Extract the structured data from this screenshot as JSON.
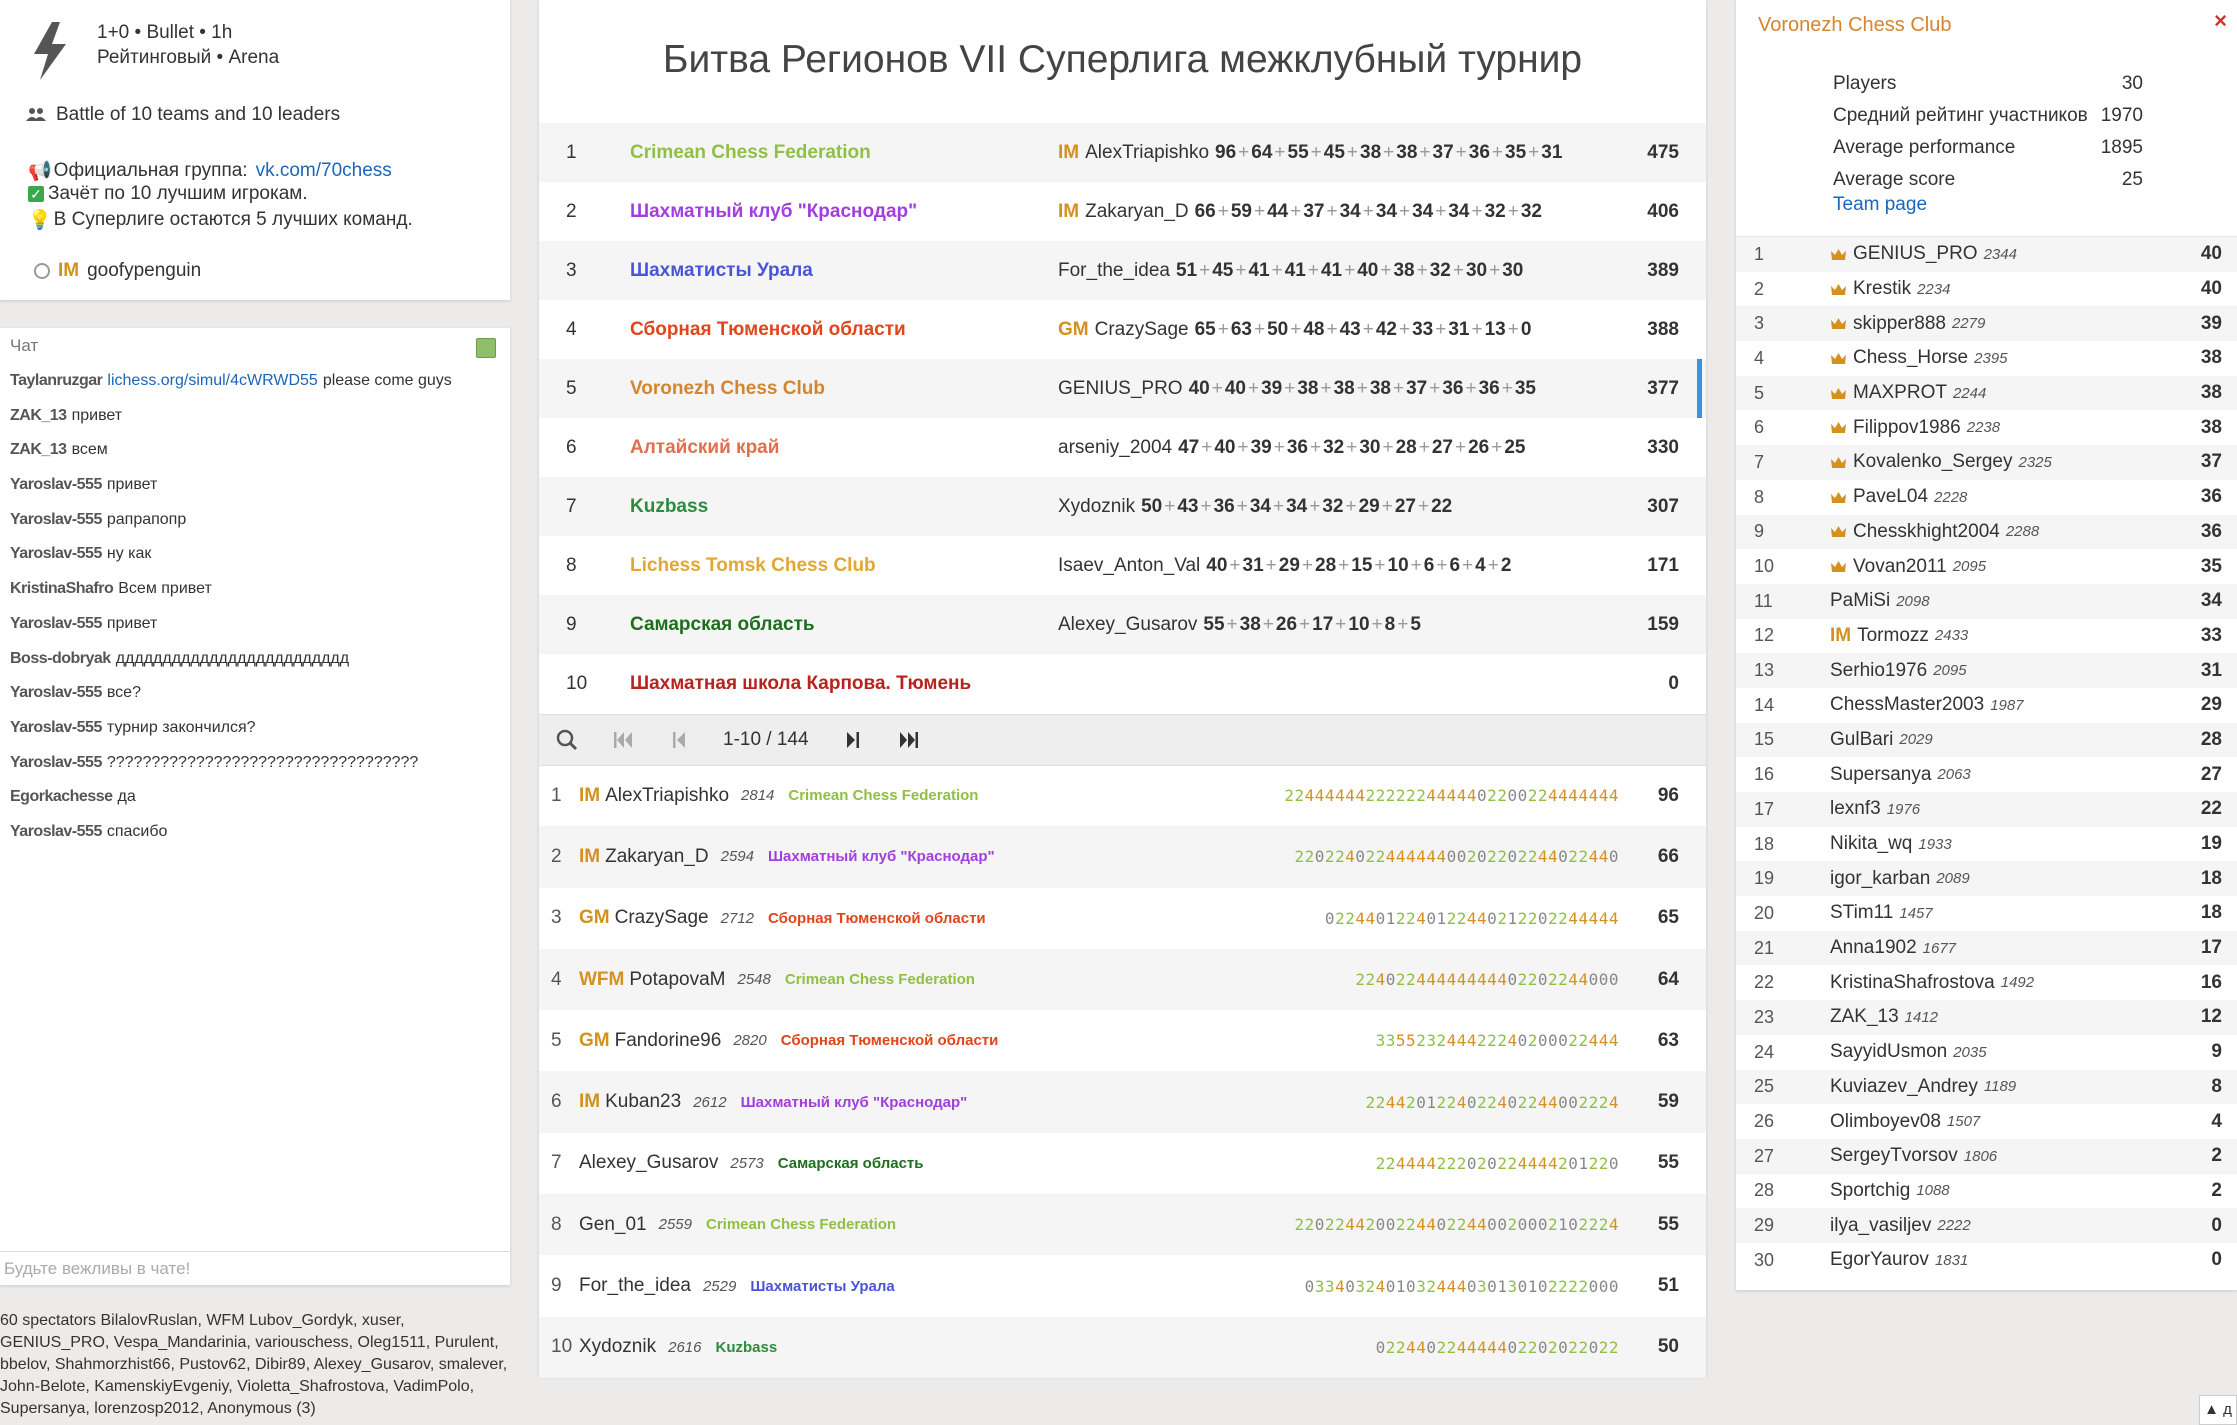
{
  "info": {
    "line1": "1+0 • Bullet • 1h",
    "line2": "Рейтинговый • Arena",
    "battle": "Battle of 10 teams and 10 leaders",
    "group_label": "Официальная группа:",
    "group_link": "vk.com/70chess",
    "rule1": "Зачёт по 10 лучшим игрокам.",
    "rule2": "В Суперлиге остаются 5 лучших команд.",
    "creator_title": "IM",
    "creator": "goofypenguin"
  },
  "chat": {
    "header": "Чат",
    "messages": [
      {
        "user": "Taylanruzgar",
        "link": "lichess.org/simul/4cWRWD55",
        "text": "please come guys"
      },
      {
        "user": "ZAK_13",
        "text": "привет"
      },
      {
        "user": "ZAK_13",
        "text": "всем"
      },
      {
        "user": "Yaroslav-555",
        "text": "привет"
      },
      {
        "user": "Yaroslav-555",
        "text": "рапрапопр"
      },
      {
        "user": "Yaroslav-555",
        "text": "ну как"
      },
      {
        "user": "KristinaShafro",
        "text": "Всем привет"
      },
      {
        "user": "Yaroslav-555",
        "text": "привет"
      },
      {
        "user": "Boss-dobryak",
        "text": "ддддддддддддддддддддддддд"
      },
      {
        "user": "Yaroslav-555",
        "text": "все?"
      },
      {
        "user": "Yaroslav-555",
        "text": "турнир закончился?"
      },
      {
        "user": "Yaroslav-555",
        "text": "???????????????????????????????????"
      },
      {
        "user": "Egorkachesse",
        "text": "да"
      },
      {
        "user": "Yaroslav-555",
        "text": "спасибо"
      }
    ],
    "placeholder": "Будьте вежливы в чате!"
  },
  "spectators": "60 spectators BilalovRuslan, WFM Lubov_Gordyk, xuser, GENIUS_PRO, Vespa_Mandarinia, variouschess, Oleg1511, Purulent, bbelov, Shahmorzhist66, Pustov62, Dibir89, Alexey_Gusarov, smalever, John-Belote, KamenskiyEvgeniy, Violetta_Shafrostova, VadimPolo, Supersanya, lorenzosp2012, Anonymous (3)",
  "tournament_title": "Битва Регионов VII Суперлига межклубный турнир",
  "teams": [
    {
      "rank": "1",
      "name": "Crimean Chess Federation",
      "color": "#8fbf44",
      "leader_title": "IM",
      "leader": "AlexTriapishko",
      "scores": [
        "96",
        "64",
        "55",
        "45",
        "38",
        "38",
        "37",
        "36",
        "35",
        "31"
      ],
      "total": "475"
    },
    {
      "rank": "2",
      "name": "Шахматный клуб \"Краснодар\"",
      "color": "#a23ee0",
      "leader_title": "IM",
      "leader": "Zakaryan_D",
      "scores": [
        "66",
        "59",
        "44",
        "37",
        "34",
        "34",
        "34",
        "34",
        "32",
        "32"
      ],
      "total": "406"
    },
    {
      "rank": "3",
      "name": "Шахматисты Урала",
      "color": "#4a55d6",
      "leader_title": "",
      "leader": "For_the_idea",
      "scores": [
        "51",
        "45",
        "41",
        "41",
        "41",
        "40",
        "38",
        "32",
        "30",
        "30"
      ],
      "total": "389"
    },
    {
      "rank": "4",
      "name": "Сборная Тюменской области",
      "color": "#e0451b",
      "leader_title": "GM",
      "leader": "CrazySage",
      "scores": [
        "65",
        "63",
        "50",
        "48",
        "43",
        "42",
        "33",
        "31",
        "13",
        "0"
      ],
      "total": "388"
    },
    {
      "rank": "5",
      "name": "Voronezh Chess Club",
      "color": "#d3852f",
      "leader_title": "",
      "leader": "GENIUS_PRO",
      "scores": [
        "40",
        "40",
        "39",
        "38",
        "38",
        "38",
        "37",
        "36",
        "36",
        "35"
      ],
      "total": "377"
    },
    {
      "rank": "6",
      "name": "Алтайский край",
      "color": "#e0704b",
      "leader_title": "",
      "leader": "arseniy_2004",
      "scores": [
        "47",
        "40",
        "39",
        "36",
        "32",
        "30",
        "28",
        "27",
        "26",
        "25"
      ],
      "total": "330"
    },
    {
      "rank": "7",
      "name": "Kuzbass",
      "color": "#2e8b3e",
      "leader_title": "",
      "leader": "Xydoznik",
      "scores": [
        "50",
        "43",
        "36",
        "34",
        "34",
        "32",
        "29",
        "27",
        "22"
      ],
      "total": "307"
    },
    {
      "rank": "8",
      "name": "Lichess Tomsk Chess Club",
      "color": "#e2a732",
      "leader_title": "",
      "leader": "Isaev_Anton_Val",
      "scores": [
        "40",
        "31",
        "29",
        "28",
        "15",
        "10",
        "6",
        "6",
        "4",
        "2"
      ],
      "total": "171"
    },
    {
      "rank": "9",
      "name": "Самарская область",
      "color": "#1d6f1d",
      "leader_title": "",
      "leader": "Alexey_Gusarov",
      "scores": [
        "55",
        "38",
        "26",
        "17",
        "10",
        "8",
        "5"
      ],
      "total": "159"
    },
    {
      "rank": "10",
      "name": "Шахматная школа Карпова. Тюмень",
      "color": "#b8231e",
      "leader_title": "",
      "leader": "",
      "scores": [],
      "total": "0"
    }
  ],
  "pager": {
    "info": "1-10 / 144"
  },
  "players": [
    {
      "rank": "1",
      "title": "IM",
      "name": "AlexTriapishko",
      "rating": "2814",
      "team": "Crimean Chess Federation",
      "team_color": "#8fbf44",
      "sheet": "224444442222224444402200224444444",
      "score": "96"
    },
    {
      "rank": "2",
      "title": "IM",
      "name": "Zakaryan_D",
      "rating": "2594",
      "team": "Шахматный клуб \"Краснодар\"",
      "team_color": "#a23ee0",
      "sheet": "22022402244444400202202244022440",
      "score": "66"
    },
    {
      "rank": "3",
      "title": "GM",
      "name": "CrazySage",
      "rating": "2712",
      "team": "Сборная Тюменской области",
      "team_color": "#e0451b",
      "sheet": "02244012240122440212202244444",
      "score": "65"
    },
    {
      "rank": "4",
      "title": "WFM",
      "name": "PotapovaM",
      "rating": "2548",
      "team": "Crimean Chess Federation",
      "team_color": "#8fbf44",
      "sheet": "22402244444444402202244000",
      "score": "64"
    },
    {
      "rank": "5",
      "title": "GM",
      "name": "Fandorine96",
      "rating": "2820",
      "team": "Сборная Тюменской области",
      "team_color": "#e0451b",
      "sheet": "335523244422240200022444",
      "score": "63"
    },
    {
      "rank": "6",
      "title": "IM",
      "name": "Kuban23",
      "rating": "2612",
      "team": "Шахматный клуб \"Краснодар\"",
      "team_color": "#a23ee0",
      "sheet": "2244201224022402244002224",
      "score": "59"
    },
    {
      "rank": "7",
      "title": "",
      "name": "Alexey_Gusarov",
      "rating": "2573",
      "team": "Самарская область",
      "team_color": "#1d6f1d",
      "sheet": "224444222020224444201220",
      "score": "55"
    },
    {
      "rank": "8",
      "title": "",
      "name": "Gen_01",
      "rating": "2559",
      "team": "Crimean Chess Federation",
      "team_color": "#8fbf44",
      "sheet": "22022442002244022440020002102224",
      "score": "55"
    },
    {
      "rank": "9",
      "title": "",
      "name": "For_the_idea",
      "rating": "2529",
      "team": "Шахматисты Урала",
      "team_color": "#4a55d6",
      "sheet": "0334032401032444030130102222000",
      "score": "51"
    },
    {
      "rank": "10",
      "title": "",
      "name": "Xydoznik",
      "rating": "2616",
      "team": "Kuzbass",
      "team_color": "#2e8b3e",
      "sheet": "022440224444402202022022",
      "score": "50"
    }
  ],
  "team_panel": {
    "name": "Voronezh Chess Club",
    "close": "×",
    "stats": [
      {
        "label": "Players",
        "value": "30"
      },
      {
        "label": "Средний рейтинг участников",
        "value": "1970"
      },
      {
        "label": "Average performance",
        "value": "1895"
      },
      {
        "label": "Average score",
        "value": "25"
      }
    ],
    "team_page": "Team page",
    "members": [
      {
        "rank": "1",
        "crown": true,
        "title": "",
        "name": "GENIUS_PRO",
        "rating": "2344",
        "score": "40"
      },
      {
        "rank": "2",
        "crown": true,
        "title": "",
        "name": "Krestik",
        "rating": "2234",
        "score": "40"
      },
      {
        "rank": "3",
        "crown": true,
        "title": "",
        "name": "skipper888",
        "rating": "2279",
        "score": "39"
      },
      {
        "rank": "4",
        "crown": true,
        "title": "",
        "name": "Chess_Horse",
        "rating": "2395",
        "score": "38"
      },
      {
        "rank": "5",
        "crown": true,
        "title": "",
        "name": "MAXPROT",
        "rating": "2244",
        "score": "38"
      },
      {
        "rank": "6",
        "crown": true,
        "title": "",
        "name": "Filippov1986",
        "rating": "2238",
        "score": "38"
      },
      {
        "rank": "7",
        "crown": true,
        "title": "",
        "name": "Kovalenko_Sergey",
        "rating": "2325",
        "score": "37"
      },
      {
        "rank": "8",
        "crown": true,
        "title": "",
        "name": "PaveL04",
        "rating": "2228",
        "score": "36"
      },
      {
        "rank": "9",
        "crown": true,
        "title": "",
        "name": "Chesskhight2004",
        "rating": "2288",
        "score": "36"
      },
      {
        "rank": "10",
        "crown": true,
        "title": "",
        "name": "Vovan2011",
        "rating": "2095",
        "score": "35"
      },
      {
        "rank": "11",
        "crown": false,
        "title": "",
        "name": "PaMiSi",
        "rating": "2098",
        "score": "34"
      },
      {
        "rank": "12",
        "crown": false,
        "title": "IM",
        "name": "Tormozz",
        "rating": "2433",
        "score": "33"
      },
      {
        "rank": "13",
        "crown": false,
        "title": "",
        "name": "Serhio1976",
        "rating": "2095",
        "score": "31"
      },
      {
        "rank": "14",
        "crown": false,
        "title": "",
        "name": "ChessMaster2003",
        "rating": "1987",
        "score": "29"
      },
      {
        "rank": "15",
        "crown": false,
        "title": "",
        "name": "GulBari",
        "rating": "2029",
        "score": "28"
      },
      {
        "rank": "16",
        "crown": false,
        "title": "",
        "name": "Supersanya",
        "rating": "2063",
        "score": "27"
      },
      {
        "rank": "17",
        "crown": false,
        "title": "",
        "name": "lexnf3",
        "rating": "1976",
        "score": "22"
      },
      {
        "rank": "18",
        "crown": false,
        "title": "",
        "name": "Nikita_wq",
        "rating": "1933",
        "score": "19"
      },
      {
        "rank": "19",
        "crown": false,
        "title": "",
        "name": "igor_karban",
        "rating": "2089",
        "score": "18"
      },
      {
        "rank": "20",
        "crown": false,
        "title": "",
        "name": "STim11",
        "rating": "1457",
        "score": "18"
      },
      {
        "rank": "21",
        "crown": false,
        "title": "",
        "name": "Anna1902",
        "rating": "1677",
        "score": "17"
      },
      {
        "rank": "22",
        "crown": false,
        "title": "",
        "name": "KristinaShafrostova",
        "rating": "1492",
        "score": "16"
      },
      {
        "rank": "23",
        "crown": false,
        "title": "",
        "name": "ZAK_13",
        "rating": "1412",
        "score": "12"
      },
      {
        "rank": "24",
        "crown": false,
        "title": "",
        "name": "SayyidUsmon",
        "rating": "2035",
        "score": "9"
      },
      {
        "rank": "25",
        "crown": false,
        "title": "",
        "name": "Kuviazev_Andrey",
        "rating": "1189",
        "score": "8"
      },
      {
        "rank": "26",
        "crown": false,
        "title": "",
        "name": "Olimboyev08",
        "rating": "1507",
        "score": "4"
      },
      {
        "rank": "27",
        "crown": false,
        "title": "",
        "name": "SergeyTvorsov",
        "rating": "1806",
        "score": "2"
      },
      {
        "rank": "28",
        "crown": false,
        "title": "",
        "name": "Sportchig",
        "rating": "1088",
        "score": "2"
      },
      {
        "rank": "29",
        "crown": false,
        "title": "",
        "name": "ilya_vasiljev",
        "rating": "2222",
        "score": "0"
      },
      {
        "rank": "30",
        "crown": false,
        "title": "",
        "name": "EgorYaurov",
        "rating": "1831",
        "score": "0"
      }
    ]
  },
  "corner_label": "▲ д",
  "colors": {
    "title": "#d59120",
    "link": "#1b66b8",
    "selected": "#3893e8",
    "sheet_four": "#d59120",
    "sheet_two": "#8fbf44"
  }
}
